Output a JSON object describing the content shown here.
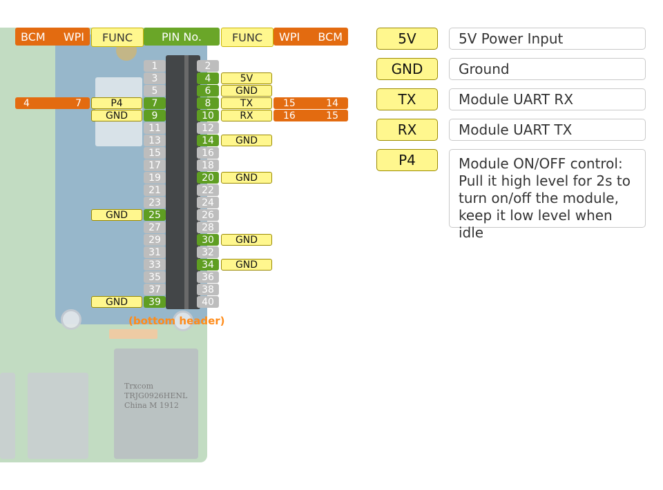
{
  "header": {
    "left_bcm": "BCM",
    "left_wpi": "WPI",
    "left_func": "FUNC",
    "pin_no": "PIN No.",
    "right_func": "FUNC",
    "right_wpi": "WPI",
    "right_bcm": "BCM"
  },
  "board_note": "(bottom header)",
  "ethernet_text": [
    "Trxcom",
    "TRJG0926HENL",
    "China M 1912"
  ],
  "pins_left": [
    {
      "num": "1"
    },
    {
      "num": "3"
    },
    {
      "num": "5"
    },
    {
      "num": "7",
      "func": "P4",
      "wpi": "7",
      "bcm": "4"
    },
    {
      "num": "9",
      "func": "GND"
    },
    {
      "num": "11"
    },
    {
      "num": "13"
    },
    {
      "num": "15"
    },
    {
      "num": "17"
    },
    {
      "num": "19"
    },
    {
      "num": "21"
    },
    {
      "num": "23"
    },
    {
      "num": "25",
      "func": "GND"
    },
    {
      "num": "27"
    },
    {
      "num": "29"
    },
    {
      "num": "31"
    },
    {
      "num": "33"
    },
    {
      "num": "35"
    },
    {
      "num": "37"
    },
    {
      "num": "39",
      "func": "GND"
    }
  ],
  "pins_right": [
    {
      "num": "2"
    },
    {
      "num": "4",
      "func": "5V"
    },
    {
      "num": "6",
      "func": "GND"
    },
    {
      "num": "8",
      "func": "TX",
      "wpi": "15",
      "bcm": "14"
    },
    {
      "num": "10",
      "func": "RX",
      "wpi": "16",
      "bcm": "15"
    },
    {
      "num": "12"
    },
    {
      "num": "14",
      "func": "GND"
    },
    {
      "num": "16"
    },
    {
      "num": "18"
    },
    {
      "num": "20",
      "func": "GND"
    },
    {
      "num": "22"
    },
    {
      "num": "24"
    },
    {
      "num": "26"
    },
    {
      "num": "28"
    },
    {
      "num": "30",
      "func": "GND"
    },
    {
      "num": "32"
    },
    {
      "num": "34",
      "func": "GND"
    },
    {
      "num": "36"
    },
    {
      "num": "38"
    },
    {
      "num": "40"
    }
  ],
  "legend": [
    {
      "key": "5V",
      "desc": "5V Power Input"
    },
    {
      "key": "GND",
      "desc": "Ground"
    },
    {
      "key": "TX",
      "desc": "Module UART RX"
    },
    {
      "key": "RX",
      "desc": "Module UART TX"
    },
    {
      "key": "P4",
      "desc_lines": [
        "Module ON/OFF control:",
        "Pull it high level for 2s to",
        "turn on/off the module,",
        "keep it low level when idle"
      ]
    }
  ],
  "colors": {
    "orange": "#e36b10",
    "yellow": "#fff78e",
    "green": "#5f9e22",
    "grey": "#bdbdbd"
  }
}
